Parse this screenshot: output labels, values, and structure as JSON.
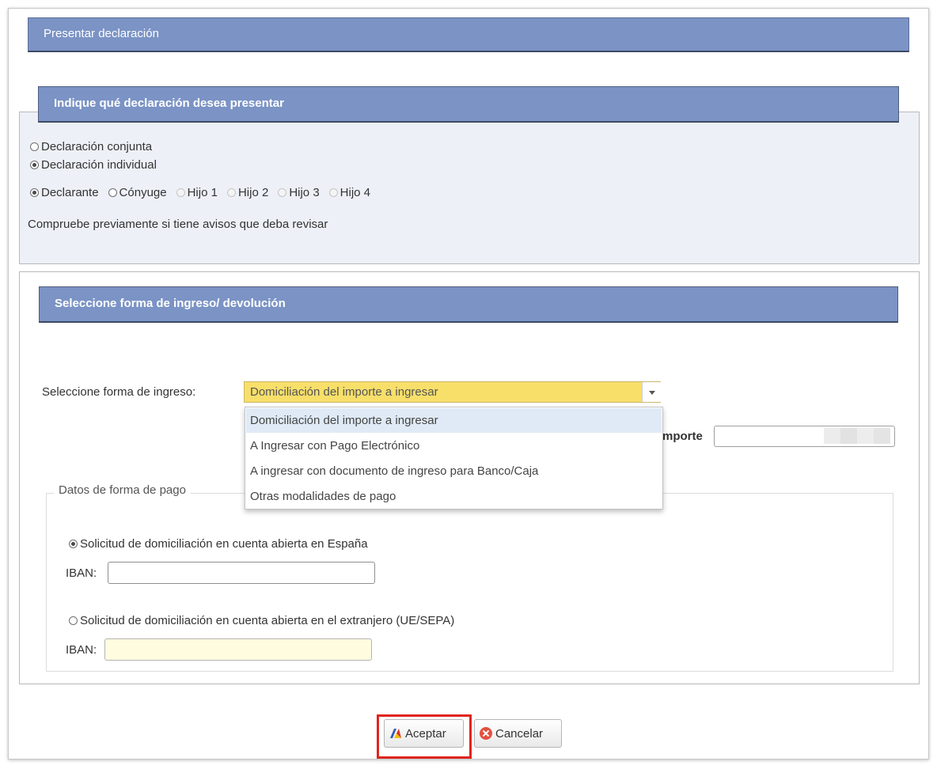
{
  "dialog": {
    "title": "Presentar declaración"
  },
  "declaracion": {
    "header": "Indique qué declaración desea presentar",
    "tipo_options": [
      {
        "label": "Declaración conjunta",
        "checked": false
      },
      {
        "label": "Declaración individual",
        "checked": true
      }
    ],
    "persona_options": [
      {
        "label": "Declarante",
        "checked": true,
        "disabled": false
      },
      {
        "label": "Cónyuge",
        "checked": false,
        "disabled": false
      },
      {
        "label": "Hijo 1",
        "checked": false,
        "disabled": true
      },
      {
        "label": "Hijo 2",
        "checked": false,
        "disabled": true
      },
      {
        "label": "Hijo 3",
        "checked": false,
        "disabled": true
      },
      {
        "label": "Hijo 4",
        "checked": false,
        "disabled": true
      }
    ],
    "aviso": "Compruebe previamente si tiene avisos que deba revisar"
  },
  "pago": {
    "header": "Seleccione forma de ingreso/ devolución",
    "forma_label": "Seleccione forma de ingreso:",
    "forma_selected": "Domiciliación del importe a ingresar",
    "forma_options": [
      "Domiciliación del importe a ingresar",
      "A Ingresar con Pago Electrónico",
      "A ingresar con documento de ingreso para Banco/Caja",
      "Otras modalidades de pago"
    ],
    "importe_label": "mporte",
    "datos_legend": "Datos de forma de pago",
    "espana_label": "Solicitud de domiciliación en cuenta abierta en España",
    "extranjero_label": "Solicitud de domiciliación en cuenta abierta en el extranjero (UE/SEPA)",
    "iban_label": "IBAN:"
  },
  "buttons": {
    "aceptar": "Aceptar",
    "cancelar": "Cancelar"
  },
  "colors": {
    "header_blue": "#7b93c5",
    "select_yellow": "#f7df6a",
    "highlight_red": "#e0241f"
  }
}
